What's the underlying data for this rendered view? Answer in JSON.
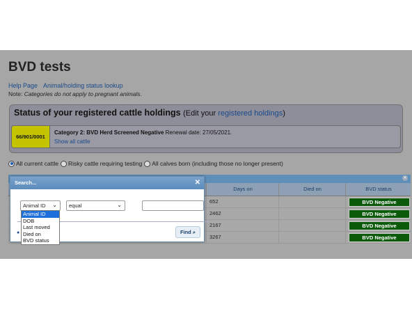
{
  "page_title": "BVD tests",
  "nav_links": [
    "Help Page",
    "Animal/holding status lookup"
  ],
  "note_prefix": "Note:",
  "note_text": "Categories do not apply to pregnant animals.",
  "status": {
    "title": "Status of your registered cattle holdings",
    "paren_prefix": "(Edit your",
    "paren_link": "registered holdings",
    "paren_suffix": ")",
    "holding": {
      "id": "66/901/0001",
      "category": "Category 2: BVD Herd Screened Negative",
      "renewal": "Renewal date: 27/05/2021.",
      "show_all": "Show all cattle"
    }
  },
  "radio_options": [
    {
      "label": "All current cattle",
      "selected": true
    },
    {
      "label": "Risky cattle requiring testing",
      "selected": false
    },
    {
      "label": "All calves born (including those no longer present)",
      "selected": false
    }
  ],
  "grid": {
    "columns": [
      "Days on",
      "Died on",
      "BVD status"
    ],
    "rows": [
      {
        "days_on": "652",
        "died_on": "",
        "bvd_status": "BVD Negative"
      },
      {
        "days_on": "2462",
        "died_on": "",
        "bvd_status": "BVD Negative"
      },
      {
        "days_on": "2167",
        "died_on": "",
        "bvd_status": "BVD Negative"
      },
      {
        "days_on": "3267",
        "died_on": "",
        "bvd_status": "BVD Negative"
      }
    ]
  },
  "dialog": {
    "title": "Search...",
    "field_selected": "Animal ID",
    "operator_selected": "equal",
    "value": "",
    "field_options": [
      "Animal ID",
      "DOB",
      "Last moved",
      "Died on",
      "BVD status"
    ],
    "find_label": "Find"
  },
  "colors": {
    "overlay": "#a6a6a6",
    "badge": "#c4c400",
    "bvd_negative": "#0a5a0a",
    "dialog_bar": "#5c8cbc",
    "link": "#1a4a8a"
  }
}
